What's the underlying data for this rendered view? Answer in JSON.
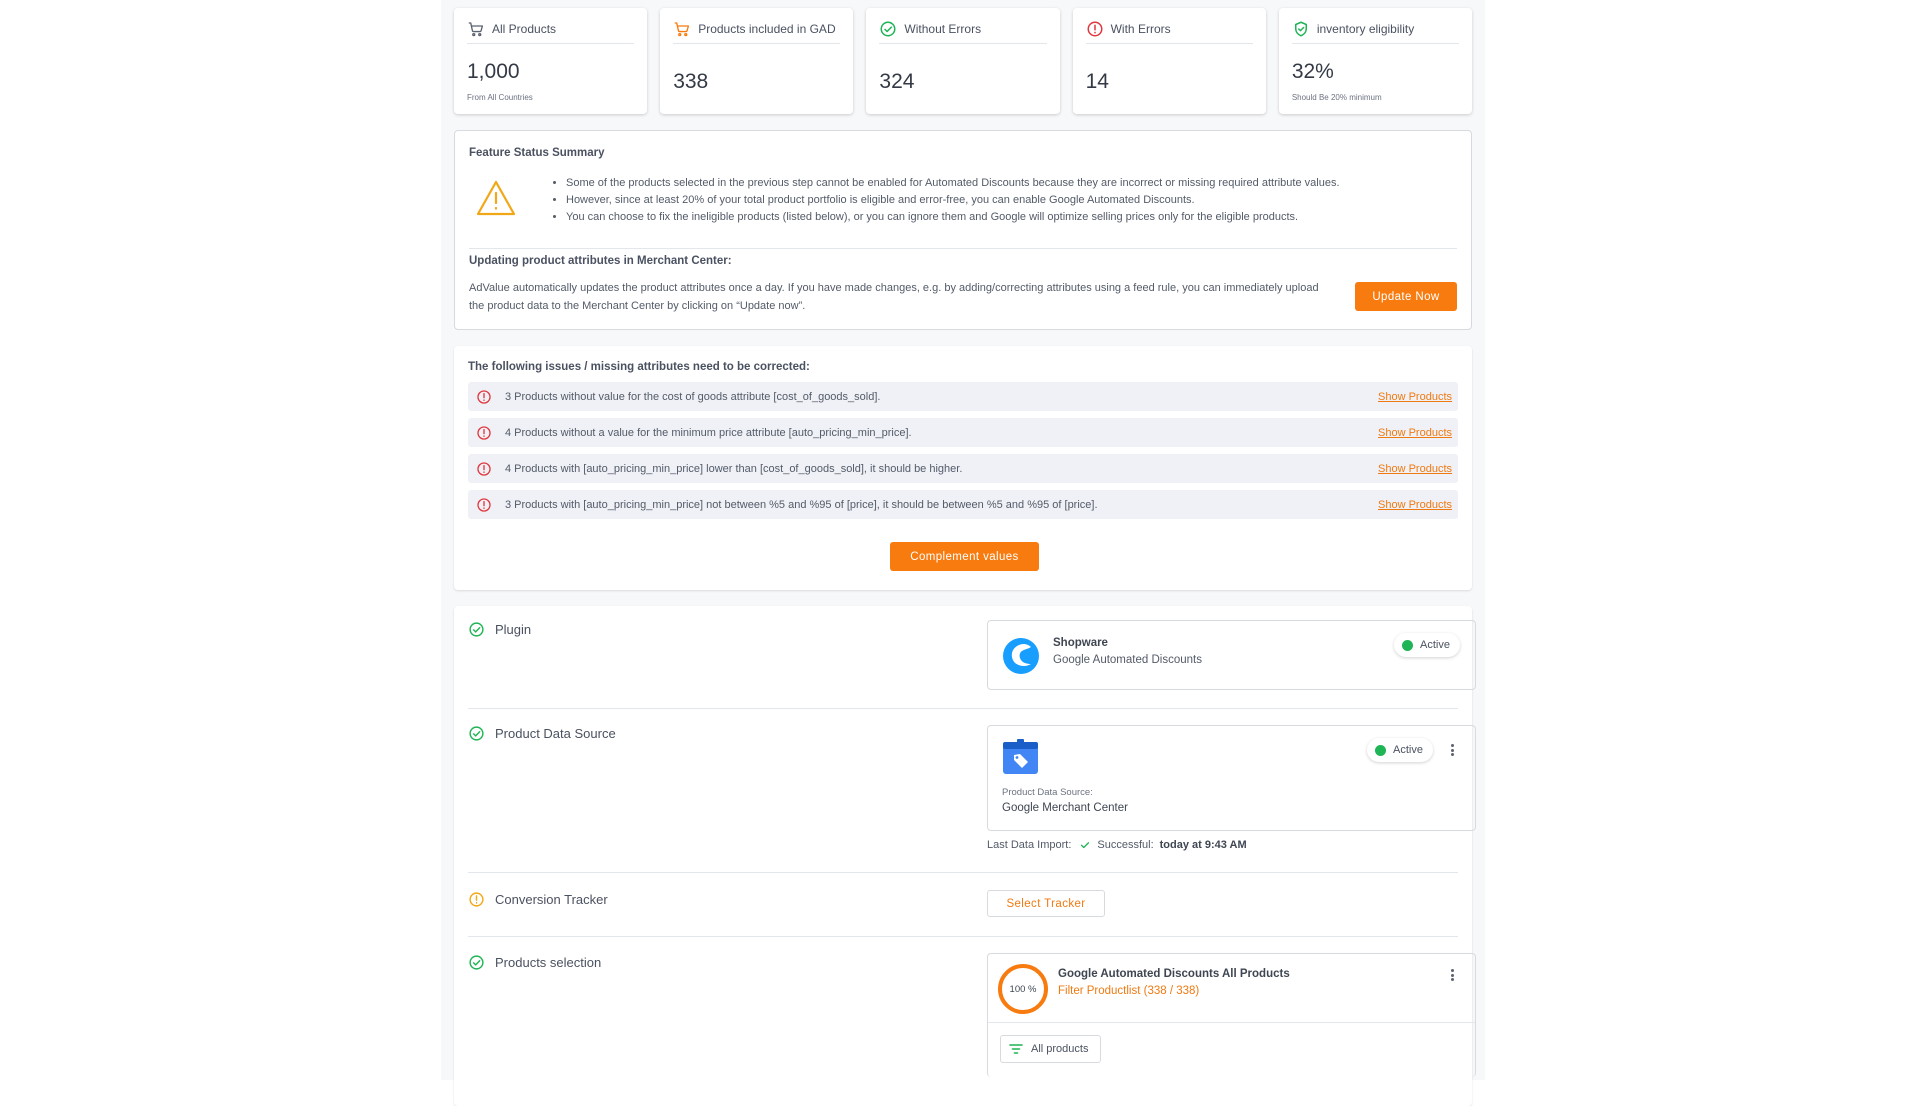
{
  "stats": [
    {
      "label": "All Products",
      "value": "1,000",
      "sub": "From All Countries",
      "icon": "cart-icon"
    },
    {
      "label": "Products included in GAD",
      "value": "338",
      "sub": "",
      "icon": "cart-icon"
    },
    {
      "label": "Without Errors",
      "value": "324",
      "sub": "",
      "icon": "check-circle-icon"
    },
    {
      "label": "With Errors",
      "value": "14",
      "sub": "",
      "icon": "error-circle-icon"
    },
    {
      "label": "inventory eligibility",
      "value": "32%",
      "sub": "Should Be 20% minimum",
      "icon": "shield-check-icon"
    }
  ],
  "summary": {
    "title": "Feature Status Summary",
    "bullets": [
      "Some of the products selected in the previous step cannot be enabled for Automated Discounts because they are incorrect or missing required attribute values.",
      "However, since at least 20% of your total product portfolio is eligible and error-free, you can enable Google Automated Discounts.",
      "You can choose to fix the ineligible products (listed below), or you can ignore them and Google will optimize selling prices only for the eligible products."
    ],
    "update_title": "Updating product attributes in Merchant Center:",
    "update_text": "AdValue automatically updates the product attributes once a day. If you have made changes, e.g. by adding/correcting attributes using a feed rule, you can immediately upload the product data to the Merchant Center by clicking on “Update now”.",
    "update_button": "Update Now"
  },
  "issues": {
    "title": "The following issues / missing attributes need to be corrected:",
    "link_label": "Show Products",
    "items": [
      "3 Products without value for the cost of goods attribute [cost_of_goods_sold].",
      "4 Products without a value for the minimum price attribute [auto_pricing_min_price].",
      "4 Products with [auto_pricing_min_price] lower than [cost_of_goods_sold], it should be higher.",
      "3 Products with [auto_pricing_min_price] not between %5 and %95 of [price], it should be between %5 and %95 of [price]."
    ],
    "complement_button": "Complement values"
  },
  "setup": {
    "plugin": {
      "title": "Plugin",
      "name": "Shopware",
      "desc": "Google Automated Discounts",
      "status": "Active"
    },
    "data_source": {
      "title": "Product Data Source",
      "status": "Active",
      "label": "Product Data Source:",
      "value": "Google Merchant Center",
      "import_label": "Last Data Import:",
      "import_status": "Successful:",
      "import_time": "today at 9:43 AM"
    },
    "tracker": {
      "title": "Conversion Tracker",
      "button": "Select Tracker"
    },
    "selection": {
      "title": "Products selection",
      "percent": "100 %",
      "percent_value": 100,
      "name": "Google Automated Discounts All Products",
      "filter": "Filter Productlist (338 / 338)",
      "chip": "All products"
    }
  },
  "colors": {
    "accent": "#f77b0f",
    "success": "#1fb455",
    "error": "#e0383e",
    "warning": "#f2a716",
    "shopware_blue": "#189eff",
    "merchant_blue": "#4285f4"
  }
}
